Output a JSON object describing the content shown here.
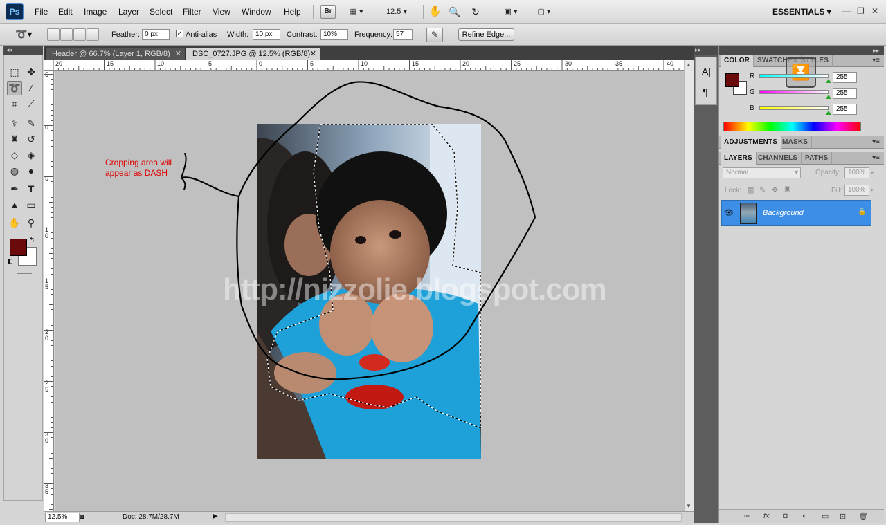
{
  "app": {
    "logo": "Ps"
  },
  "menu": [
    "File",
    "Edit",
    "Image",
    "Layer",
    "Select",
    "Filter",
    "View",
    "Window",
    "Help"
  ],
  "menubar": {
    "bridge": "Br",
    "zoom": "12.5",
    "workspace": "ESSENTIALS"
  },
  "options": {
    "feather_label": "Feather:",
    "feather_value": "0 px",
    "antialias_label": "Anti-alias",
    "width_label": "Width:",
    "width_value": "10 px",
    "contrast_label": "Contrast:",
    "contrast_value": "10%",
    "frequency_label": "Frequency:",
    "frequency_value": "57",
    "refine_edge": "Refine Edge..."
  },
  "tabs": [
    {
      "label": "Header @ 66.7% (Layer 1, RGB/8)"
    },
    {
      "label": "DSC_0727.JPG @ 12.5% (RGB/8)"
    }
  ],
  "ruler_h": [
    "20",
    "15",
    "10",
    "5",
    "0",
    "5",
    "10",
    "15",
    "20",
    "25",
    "30",
    "35",
    "40"
  ],
  "ruler_v": [
    "5",
    "0",
    "5",
    "1\n0",
    "1\n5",
    "2\n0",
    "2\n5",
    "3\n0",
    "3\n5"
  ],
  "annotation": {
    "line1": "Cropping area will",
    "line2": "appear as DASH"
  },
  "watermark": "http://nizzolie.blogspot.com",
  "status": {
    "zoom": "12.5%",
    "doc": "Doc: 28.7M/28.7M"
  },
  "color_panel": {
    "tabs": [
      "COLOR",
      "SWATCHES",
      "STYLES"
    ],
    "r_label": "R",
    "g_label": "G",
    "b_label": "B",
    "r": "255",
    "g": "255",
    "b": "255",
    "foreground": "#6b0a0a",
    "background": "#ffffff"
  },
  "adjust_panel": {
    "tabs": [
      "ADJUSTMENTS",
      "MASKS"
    ]
  },
  "layers_panel": {
    "tabs": [
      "LAYERS",
      "CHANNELS",
      "PATHS"
    ],
    "blend_mode": "Normal",
    "opacity_label": "Opacity:",
    "opacity": "100%",
    "lock_label": "Lock:",
    "fill_label": "Fill:",
    "fill": "100%",
    "layers": [
      {
        "name": "Background"
      }
    ]
  },
  "colors": {
    "selection_blue": "#3c8ee6",
    "annotation_red": "#e00000"
  }
}
